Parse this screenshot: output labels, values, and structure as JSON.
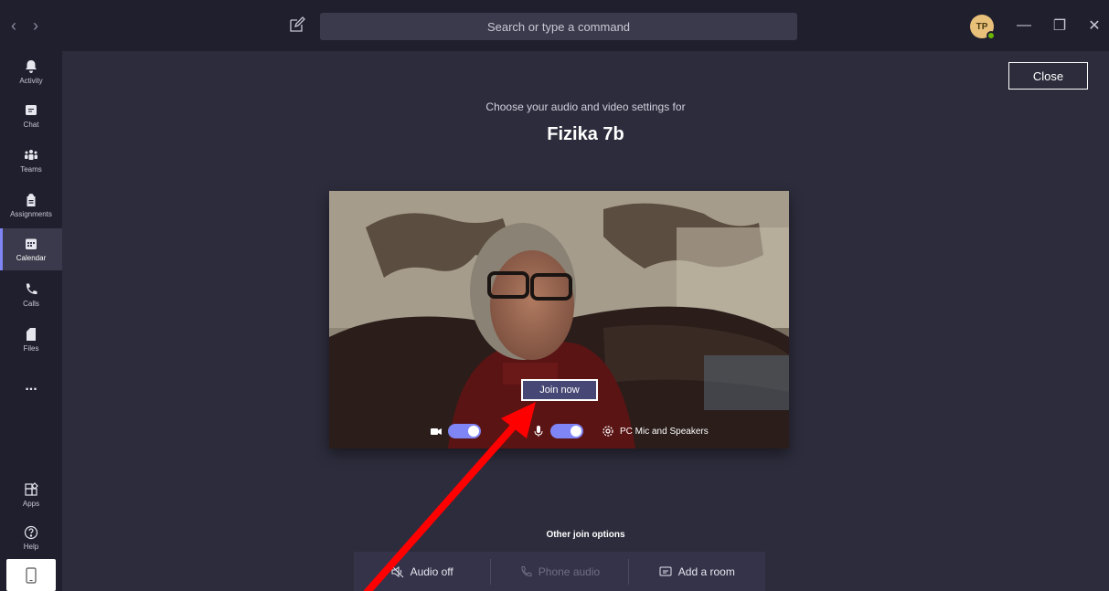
{
  "titlebar": {
    "back_icon": "chevron-left-icon",
    "forward_icon": "chevron-right-icon",
    "compose_icon": "compose-icon",
    "search_placeholder": "Search or type a command",
    "avatar_initials": "TP",
    "presence_color": "#6bb700",
    "window_buttons": [
      "minimize-icon",
      "restore-icon",
      "close-icon"
    ]
  },
  "rail": {
    "items": [
      {
        "label": "Activity",
        "icon": "bell-icon"
      },
      {
        "label": "Chat",
        "icon": "chat-icon"
      },
      {
        "label": "Teams",
        "icon": "teams-icon"
      },
      {
        "label": "Assignments",
        "icon": "assignments-icon"
      },
      {
        "label": "Calendar",
        "icon": "calendar-icon",
        "active": true
      },
      {
        "label": "Calls",
        "icon": "phone-icon"
      },
      {
        "label": "Files",
        "icon": "file-icon"
      }
    ],
    "more_label": "...",
    "bottom": [
      {
        "label": "Apps",
        "icon": "apps-icon"
      },
      {
        "label": "Help",
        "icon": "help-icon"
      }
    ],
    "device_icon": "mobile-device-icon"
  },
  "main": {
    "close_label": "Close",
    "subtitle": "Choose your audio and video settings for",
    "meeting_title": "Fizika 7b",
    "join_label": "Join now",
    "video_on": true,
    "mic_on": true,
    "device_label": "PC Mic and Speakers",
    "other_title": "Other join options",
    "options": [
      {
        "label": "Audio off",
        "icon": "speaker-off-icon",
        "enabled": true
      },
      {
        "label": "Phone audio",
        "icon": "phone-icon",
        "enabled": false
      },
      {
        "label": "Add a room",
        "icon": "cast-room-icon",
        "enabled": true
      }
    ]
  },
  "colors": {
    "accent": "#7f85f5",
    "join_button": "#464775",
    "annotation_arrow": "#ff0000"
  }
}
